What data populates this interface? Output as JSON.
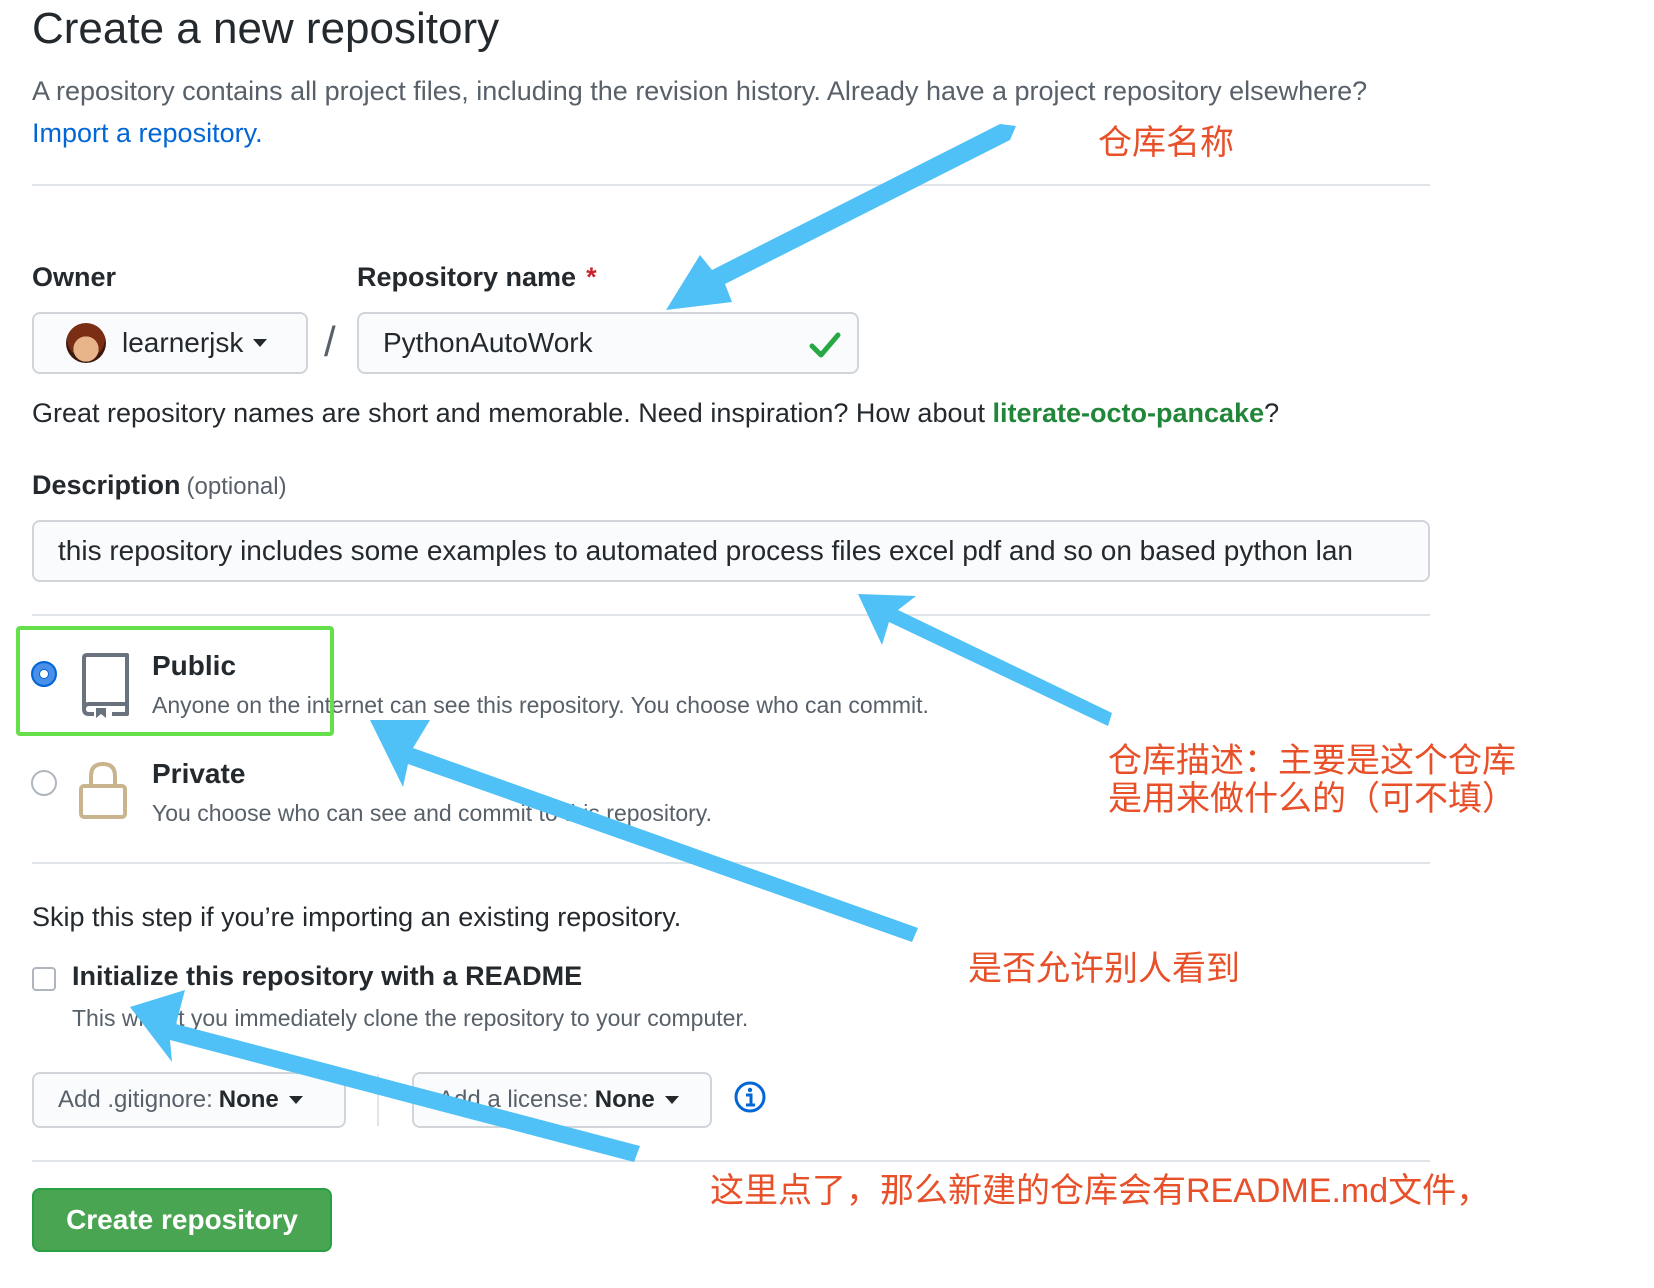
{
  "header": {
    "title": "Create a new repository",
    "subtitle": "A repository contains all project files, including the revision history. Already have a project repository elsewhere?",
    "import_link": "Import a repository."
  },
  "owner": {
    "label": "Owner",
    "value": "learnerjsk"
  },
  "repo_name": {
    "label": "Repository name",
    "required_mark": "*",
    "value": "PythonAutoWork",
    "separator": "/"
  },
  "hint": {
    "text": "Great repository names are short and memorable. Need inspiration? How about",
    "suggestion": "literate-octo-pancake",
    "suffix": "?"
  },
  "description": {
    "label": "Description",
    "optional": "(optional)",
    "value": "this repository includes some examples to automated process files excel pdf and so on based python lan"
  },
  "visibility": {
    "public": {
      "title": "Public",
      "note": "Anyone on the internet can see this repository. You choose who can commit.",
      "selected": true
    },
    "private": {
      "title": "Private",
      "note": "You choose who can see and commit to this repository.",
      "selected": false
    }
  },
  "init": {
    "skip_text": "Skip this step if you’re importing an existing repository.",
    "readme_label": "Initialize this repository with a README",
    "readme_note": "This will let you immediately clone the repository to your computer.",
    "checked": false
  },
  "gitignore": {
    "label": "Add .gitignore:",
    "value": "None"
  },
  "license": {
    "label": "Add a license:",
    "value": "None"
  },
  "create_button": "Create repository",
  "annotations": {
    "name": "仓库名称",
    "desc_line1": "仓库描述：主要是这个仓库",
    "desc_line2": "是用来做什么的（可不填）",
    "visibility": "是否允许别人看到",
    "readme": "这里点了，那么新建的仓库会有README.md文件，"
  },
  "colors": {
    "link": "#0366d6",
    "suggestion": "#22863a",
    "create_button": "#4aa552",
    "annotation_text": "#e8502a",
    "annotation_arrow": "#4fc1f7",
    "highlight_box": "#66e04a"
  }
}
